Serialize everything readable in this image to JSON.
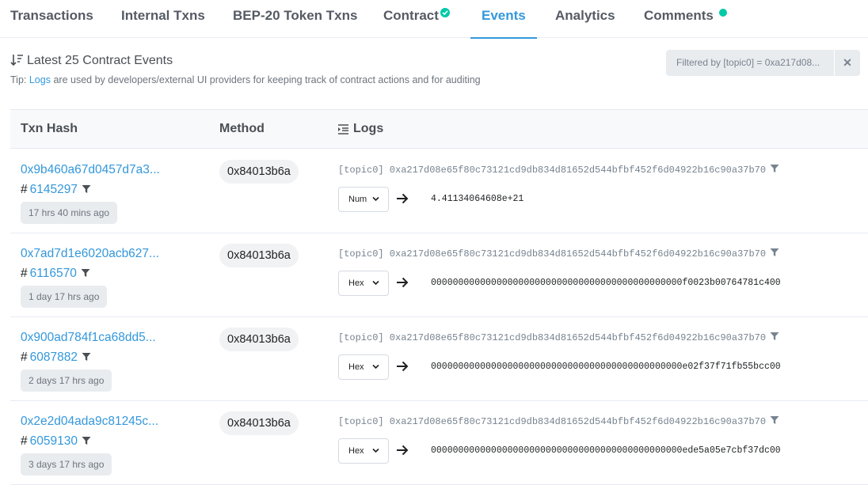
{
  "tabs": [
    {
      "label": "Transactions"
    },
    {
      "label": "Internal Txns"
    },
    {
      "label": "BEP-20 Token Txns"
    },
    {
      "label": "Contract"
    },
    {
      "label": "Events"
    },
    {
      "label": "Analytics"
    },
    {
      "label": "Comments"
    }
  ],
  "active_tab": "Events",
  "events_title": "Latest 25 Contract Events",
  "tip": {
    "prefix": "Tip:",
    "link": "Logs",
    "text": "are used by developers/external UI providers for keeping track of contract actions and for auditing"
  },
  "filter": {
    "label": "Filtered by [topic0] = 0xa217d08...",
    "close": "✕"
  },
  "table": {
    "headers": {
      "txhash": "Txn Hash",
      "method": "Method",
      "logs": "Logs"
    },
    "rows": [
      {
        "txhash": "0x9b460a67d0457d7a3...",
        "hash_symbol": "#",
        "block": "6145297",
        "age": "17 hrs 40 mins ago",
        "method": "0x84013b6a",
        "topic": "[topic0] 0xa217d08e65f80c73121cd9db834d81652d544bfbf452f6d04922b16c90a37b70",
        "format": "Num",
        "value": "4.41134064608e+21"
      },
      {
        "txhash": "0x7ad7d1e6020acb627...",
        "hash_symbol": "#",
        "block": "6116570",
        "age": "1 day 17 hrs ago",
        "method": "0x84013b6a",
        "topic": "[topic0] 0xa217d08e65f80c73121cd9db834d81652d544bfbf452f6d04922b16c90a37b70",
        "format": "Hex",
        "value": "0000000000000000000000000000000000000000000000f0023b00764781c400"
      },
      {
        "txhash": "0x900ad784f1ca68dd5...",
        "hash_symbol": "#",
        "block": "6087882",
        "age": "2 days 17 hrs ago",
        "method": "0x84013b6a",
        "topic": "[topic0] 0xa217d08e65f80c73121cd9db834d81652d544bfbf452f6d04922b16c90a37b70",
        "format": "Hex",
        "value": "0000000000000000000000000000000000000000000000e02f37f71fb55bcc00"
      },
      {
        "txhash": "0x2e2d04ada9c81245c...",
        "hash_symbol": "#",
        "block": "6059130",
        "age": "3 days 17 hrs ago",
        "method": "0x84013b6a",
        "topic": "[topic0] 0xa217d08e65f80c73121cd9db834d81652d544bfbf452f6d04922b16c90a37b70",
        "format": "Hex",
        "value": "0000000000000000000000000000000000000000000000ede5a05e7cbf37dc00"
      }
    ]
  },
  "colors": {
    "link": "#3498db",
    "success": "#00c9a7",
    "muted": "#77838f"
  }
}
